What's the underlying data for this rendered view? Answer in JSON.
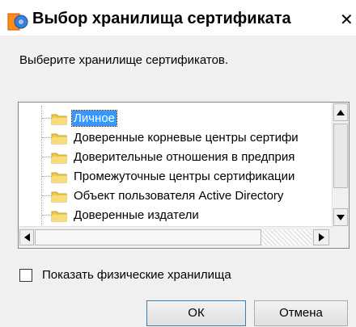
{
  "window": {
    "title": "Выбор хранилища сертификата",
    "close_glyph": "✕"
  },
  "prompt": "Выберите хранилище сертификатов.",
  "tree": {
    "items": [
      {
        "label": "Личное",
        "selected": true
      },
      {
        "label": "Доверенные корневые центры сертифи",
        "selected": false
      },
      {
        "label": "Доверительные отношения в предприя",
        "selected": false
      },
      {
        "label": "Промежуточные центры сертификации",
        "selected": false
      },
      {
        "label": "Объект пользователя Active Directory",
        "selected": false
      },
      {
        "label": "Доверенные издатели",
        "selected": false
      }
    ]
  },
  "checkbox": {
    "label": "Показать физические хранилища",
    "checked": false
  },
  "buttons": {
    "ok": "ОК",
    "cancel": "Отмена"
  },
  "colors": {
    "selection": "#3399ff",
    "folder": "#f0c84a"
  },
  "icons": {
    "app": "certificate-app-icon",
    "folder": "folder-icon",
    "scroll_up": "arrow-up-icon",
    "scroll_down": "arrow-down-icon",
    "scroll_left": "arrow-left-icon",
    "scroll_right": "arrow-right-icon"
  }
}
